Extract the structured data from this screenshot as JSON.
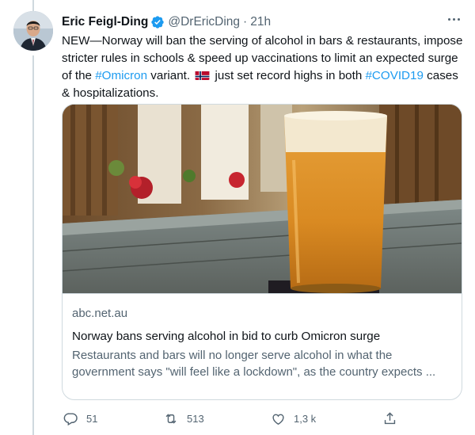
{
  "tweet": {
    "author_name": "Eric Feigl-Ding",
    "handle": "@DrEricDing",
    "separator": "·",
    "time": "21h",
    "text_parts": {
      "p1": "NEW—Norway will ban the serving of alcohol in bars & restaurants, impose stricter rules in schools & speed up vaccinations to limit an expected surge of the ",
      "hashtag1": "#Omicron",
      "p2": " variant. ",
      "p3": " just set record highs in both ",
      "hashtag2": "#COVID19",
      "p4": " cases & hospitalizations."
    },
    "flag_icon": "norway-flag-icon"
  },
  "card": {
    "domain": "abc.net.au",
    "title": "Norway bans serving alcohol in bid to curb Omicron surge",
    "description": "Restaurants and bars will no longer serve alcohol in what the\ngovernment says \"will feel like a lockdown\", as the country expects ..."
  },
  "actions": {
    "reply_count": "51",
    "retweet_count": "513",
    "like_count": "1,3 k",
    "icons": [
      "reply-icon",
      "retweet-icon",
      "like-icon",
      "share-icon"
    ]
  },
  "colors": {
    "link": "#1d9bf0",
    "secondary_text": "#536471",
    "border": "#cfd9de",
    "verified": "#1d9bf0"
  }
}
